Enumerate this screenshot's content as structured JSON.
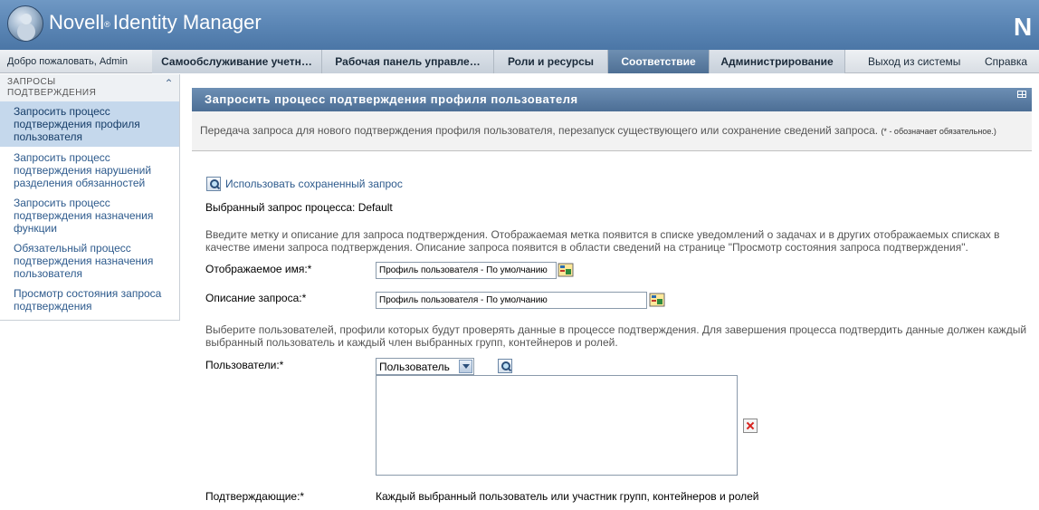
{
  "app": {
    "brand": "Novell",
    "reg": "®",
    "product": "Identity Manager",
    "corner_logo": "N"
  },
  "nav": {
    "welcome": "Добро пожаловать, Admin",
    "tabs": [
      "Самообслуживание учетн…",
      "Рабочая панель управле…",
      "Роли и ресурсы",
      "Соответствие",
      "Администрирование"
    ],
    "active_tab": "Соответствие",
    "logout": "Выход из системы",
    "help": "Справка"
  },
  "sidebar": {
    "header_line1": "ЗАПРОСЫ",
    "header_line2": "ПОДТВЕРЖДЕНИЯ",
    "collapse_icon": "double-chevron-up-icon",
    "items": [
      {
        "label": "Запросить процесс подтверждения профиля пользователя",
        "selected": true
      },
      {
        "label": "Запросить процесс подтверждения нарушений разделения обязанностей",
        "selected": false
      },
      {
        "label": "Запросить процесс подтверждения назначения функции",
        "selected": false
      },
      {
        "label": "Обязательный процесс подтверждения назначения пользователя",
        "selected": false
      },
      {
        "label": "Просмотр состояния запроса подтверждения",
        "selected": false
      }
    ]
  },
  "panel": {
    "title": "Запросить процесс подтверждения профиля пользователя",
    "description": "Передача запроса для нового подтверждения профиля пользователя, перезапуск существующего или сохранение сведений запроса.",
    "required_note": "(* - обозначает обязательное.)"
  },
  "form": {
    "use_saved_label": "Использовать сохраненный запрос",
    "selected_request_label": "Выбранный запрос процесса: Default",
    "hint_label": "Введите метку и описание для запроса подтверждения. Отображаемая метка появится в списке уведомлений о задачах и в других отображаемых списках в качестве имени запроса подтверждения. Описание запроса появится в области сведений на странице \"Просмотр состояния запроса подтверждения\".",
    "display_name_label": "Отображаемое имя:*",
    "display_name_value": "Профиль пользователя - По умолчанию",
    "description_label": "Описание запроса:*",
    "description_value": "Профиль пользователя - По умолчанию",
    "hint_users": "Выберите пользователей, профили которых будут проверять данные в процессе подтверждения. Для завершения процесса подтвердить данные должен каждый выбранный пользователь и каждый член выбранных групп, контейнеров и ролей.",
    "users_label": "Пользователи:*",
    "user_type_selected": "Пользователь",
    "attesters_label": "Подтверждающие:*",
    "attesters_value": "Каждый выбранный пользователь или участник групп, контейнеров и ролей"
  },
  "colors": {
    "header_blue": "#5b86b5",
    "active_tab": "#4e6f94",
    "link": "#2d5a8c",
    "selected_side": "#c5d8ec"
  }
}
